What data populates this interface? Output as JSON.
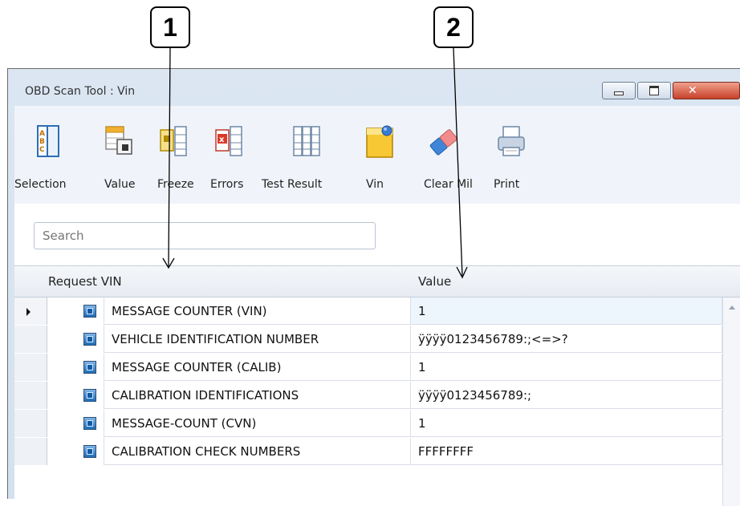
{
  "callouts": [
    "1",
    "2"
  ],
  "window": {
    "title": "OBD Scan Tool : Vin"
  },
  "toolbar": {
    "items": [
      {
        "label": "Selection",
        "icon": "selection-icon"
      },
      {
        "label": "Value",
        "icon": "value-icon"
      },
      {
        "label": "Freeze",
        "icon": "freeze-icon"
      },
      {
        "label": "Errors",
        "icon": "errors-icon"
      },
      {
        "label": "Test Result",
        "icon": "test-result-icon"
      },
      {
        "label": "Vin",
        "icon": "vin-icon"
      },
      {
        "label": "Clear Mil",
        "icon": "eraser-icon"
      },
      {
        "label": "Print",
        "icon": "printer-icon"
      }
    ]
  },
  "search": {
    "placeholder": "Search"
  },
  "grid": {
    "columns": [
      "Request VIN",
      "Value"
    ],
    "rows": [
      {
        "name": "MESSAGE COUNTER (VIN)",
        "value": "1"
      },
      {
        "name": "VEHICLE IDENTIFICATION NUMBER",
        "value": "ÿÿÿÿ0123456789:;<=>?"
      },
      {
        "name": "MESSAGE COUNTER (CALIB)",
        "value": "1"
      },
      {
        "name": "CALIBRATION IDENTIFICATIONS",
        "value": "ÿÿÿÿ0123456789:;"
      },
      {
        "name": "MESSAGE-COUNT (CVN)",
        "value": "1"
      },
      {
        "name": "CALIBRATION CHECK NUMBERS",
        "value": "FFFFFFFF"
      }
    ]
  }
}
